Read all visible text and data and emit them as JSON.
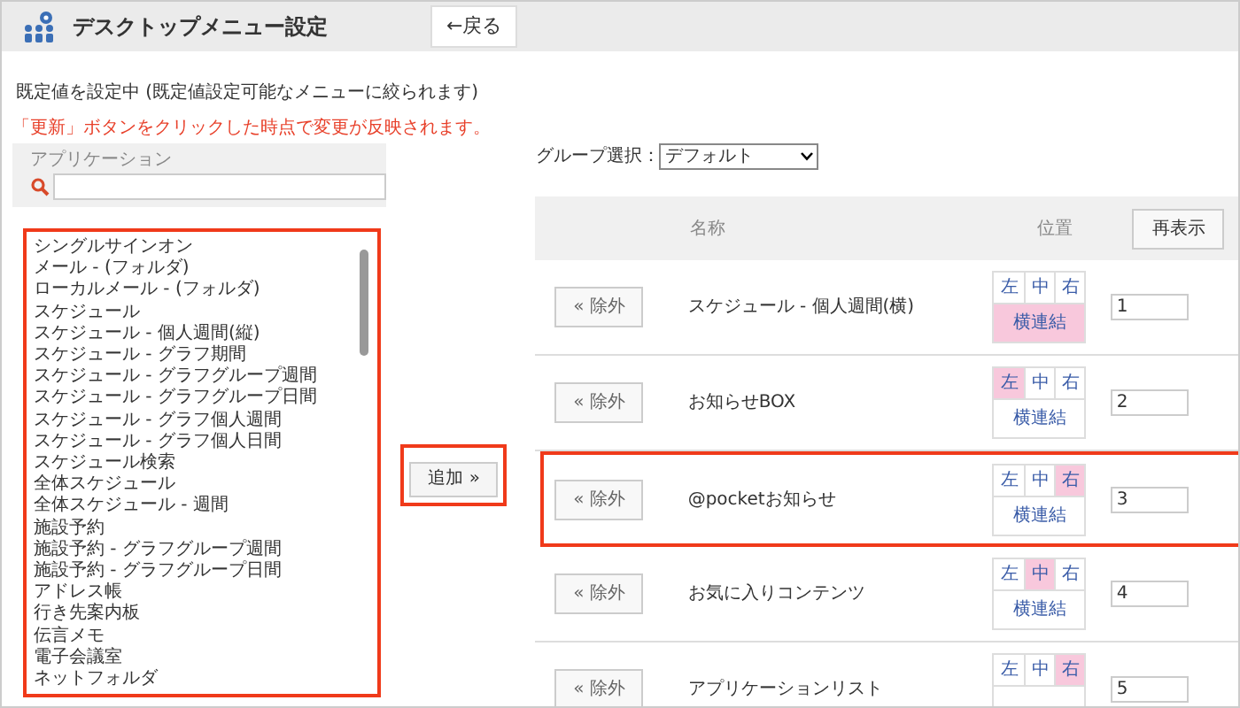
{
  "header": {
    "title": "デスクトップメニュー設定",
    "back_button": "←戻る"
  },
  "info": "既定値を設定中 (既定値設定可能なメニューに絞られます)",
  "warning": "「更新」ボタンをクリックした時点で変更が反映されます。",
  "application_filter": {
    "label": "アプリケーション"
  },
  "application_list": {
    "highlighted": true,
    "items": [
      "シングルサインオン",
      "メール - (フォルダ)",
      "ローカルメール - (フォルダ)",
      "スケジュール",
      "スケジュール - 個人週間(縦)",
      "スケジュール - グラフ期間",
      "スケジュール - グラフグループ週間",
      "スケジュール - グラフグループ日間",
      "スケジュール - グラフ個人週間",
      "スケジュール - グラフ個人日間",
      "スケジュール検索",
      "全体スケジュール",
      "全体スケジュール - 週間",
      "施設予約",
      "施設予約 - グラフグループ週間",
      "施設予約 - グラフグループ日間",
      "アドレス帳",
      "行き先案内板",
      "伝言メモ",
      "電子会議室",
      "ネットフォルダ"
    ]
  },
  "add_button": {
    "label": "追加 »",
    "highlighted": true
  },
  "group_select": {
    "label": "グループ選択：",
    "value": "デフォルト"
  },
  "table": {
    "columns": [
      "名称",
      "位置"
    ],
    "refresh_button": "再表示",
    "rows": [
      {
        "remove": "« 除外",
        "name": "スケジュール - 個人週間(横)",
        "highlighted": false,
        "positions": [
          {
            "label": "左",
            "selected": false
          },
          {
            "label": "中",
            "selected": false
          },
          {
            "label": "右",
            "selected": false
          }
        ],
        "joined": {
          "label": "横連結",
          "selected": true
        },
        "order": "1"
      },
      {
        "remove": "« 除外",
        "name": "お知らせBOX",
        "highlighted": false,
        "positions": [
          {
            "label": "左",
            "selected": true
          },
          {
            "label": "中",
            "selected": false
          },
          {
            "label": "右",
            "selected": false
          }
        ],
        "joined": {
          "label": "横連結",
          "selected": false
        },
        "order": "2"
      },
      {
        "remove": "« 除外",
        "name": "@pocketお知らせ",
        "highlighted": true,
        "positions": [
          {
            "label": "左",
            "selected": false
          },
          {
            "label": "中",
            "selected": false
          },
          {
            "label": "右",
            "selected": true
          }
        ],
        "joined": {
          "label": "横連結",
          "selected": false
        },
        "order": "3"
      },
      {
        "remove": "« 除外",
        "name": "お気に入りコンテンツ",
        "highlighted": false,
        "positions": [
          {
            "label": "左",
            "selected": false
          },
          {
            "label": "中",
            "selected": true
          },
          {
            "label": "右",
            "selected": false
          }
        ],
        "joined": {
          "label": "横連結",
          "selected": false
        },
        "order": "4"
      },
      {
        "remove": "« 除外",
        "name": "アプリケーションリスト",
        "highlighted": false,
        "positions": [
          {
            "label": "左",
            "selected": false
          },
          {
            "label": "中",
            "selected": false
          },
          {
            "label": "右",
            "selected": true
          }
        ],
        "order": "5"
      }
    ]
  }
}
